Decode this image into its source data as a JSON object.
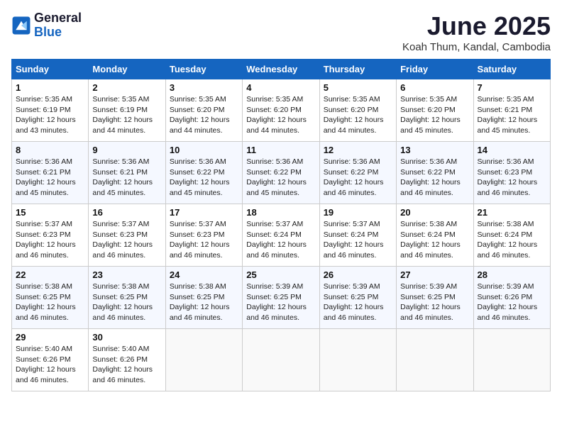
{
  "logo": {
    "line1": "General",
    "line2": "Blue"
  },
  "title": "June 2025",
  "subtitle": "Koah Thum, Kandal, Cambodia",
  "days_of_week": [
    "Sunday",
    "Monday",
    "Tuesday",
    "Wednesday",
    "Thursday",
    "Friday",
    "Saturday"
  ],
  "weeks": [
    [
      {
        "day": 1,
        "sunrise": "5:35 AM",
        "sunset": "6:19 PM",
        "daylight": "12 hours and 43 minutes."
      },
      {
        "day": 2,
        "sunrise": "5:35 AM",
        "sunset": "6:19 PM",
        "daylight": "12 hours and 44 minutes."
      },
      {
        "day": 3,
        "sunrise": "5:35 AM",
        "sunset": "6:20 PM",
        "daylight": "12 hours and 44 minutes."
      },
      {
        "day": 4,
        "sunrise": "5:35 AM",
        "sunset": "6:20 PM",
        "daylight": "12 hours and 44 minutes."
      },
      {
        "day": 5,
        "sunrise": "5:35 AM",
        "sunset": "6:20 PM",
        "daylight": "12 hours and 44 minutes."
      },
      {
        "day": 6,
        "sunrise": "5:35 AM",
        "sunset": "6:20 PM",
        "daylight": "12 hours and 45 minutes."
      },
      {
        "day": 7,
        "sunrise": "5:35 AM",
        "sunset": "6:21 PM",
        "daylight": "12 hours and 45 minutes."
      }
    ],
    [
      {
        "day": 8,
        "sunrise": "5:36 AM",
        "sunset": "6:21 PM",
        "daylight": "12 hours and 45 minutes."
      },
      {
        "day": 9,
        "sunrise": "5:36 AM",
        "sunset": "6:21 PM",
        "daylight": "12 hours and 45 minutes."
      },
      {
        "day": 10,
        "sunrise": "5:36 AM",
        "sunset": "6:22 PM",
        "daylight": "12 hours and 45 minutes."
      },
      {
        "day": 11,
        "sunrise": "5:36 AM",
        "sunset": "6:22 PM",
        "daylight": "12 hours and 45 minutes."
      },
      {
        "day": 12,
        "sunrise": "5:36 AM",
        "sunset": "6:22 PM",
        "daylight": "12 hours and 46 minutes."
      },
      {
        "day": 13,
        "sunrise": "5:36 AM",
        "sunset": "6:22 PM",
        "daylight": "12 hours and 46 minutes."
      },
      {
        "day": 14,
        "sunrise": "5:36 AM",
        "sunset": "6:23 PM",
        "daylight": "12 hours and 46 minutes."
      }
    ],
    [
      {
        "day": 15,
        "sunrise": "5:37 AM",
        "sunset": "6:23 PM",
        "daylight": "12 hours and 46 minutes."
      },
      {
        "day": 16,
        "sunrise": "5:37 AM",
        "sunset": "6:23 PM",
        "daylight": "12 hours and 46 minutes."
      },
      {
        "day": 17,
        "sunrise": "5:37 AM",
        "sunset": "6:23 PM",
        "daylight": "12 hours and 46 minutes."
      },
      {
        "day": 18,
        "sunrise": "5:37 AM",
        "sunset": "6:24 PM",
        "daylight": "12 hours and 46 minutes."
      },
      {
        "day": 19,
        "sunrise": "5:37 AM",
        "sunset": "6:24 PM",
        "daylight": "12 hours and 46 minutes."
      },
      {
        "day": 20,
        "sunrise": "5:38 AM",
        "sunset": "6:24 PM",
        "daylight": "12 hours and 46 minutes."
      },
      {
        "day": 21,
        "sunrise": "5:38 AM",
        "sunset": "6:24 PM",
        "daylight": "12 hours and 46 minutes."
      }
    ],
    [
      {
        "day": 22,
        "sunrise": "5:38 AM",
        "sunset": "6:25 PM",
        "daylight": "12 hours and 46 minutes."
      },
      {
        "day": 23,
        "sunrise": "5:38 AM",
        "sunset": "6:25 PM",
        "daylight": "12 hours and 46 minutes."
      },
      {
        "day": 24,
        "sunrise": "5:38 AM",
        "sunset": "6:25 PM",
        "daylight": "12 hours and 46 minutes."
      },
      {
        "day": 25,
        "sunrise": "5:39 AM",
        "sunset": "6:25 PM",
        "daylight": "12 hours and 46 minutes."
      },
      {
        "day": 26,
        "sunrise": "5:39 AM",
        "sunset": "6:25 PM",
        "daylight": "12 hours and 46 minutes."
      },
      {
        "day": 27,
        "sunrise": "5:39 AM",
        "sunset": "6:25 PM",
        "daylight": "12 hours and 46 minutes."
      },
      {
        "day": 28,
        "sunrise": "5:39 AM",
        "sunset": "6:26 PM",
        "daylight": "12 hours and 46 minutes."
      }
    ],
    [
      {
        "day": 29,
        "sunrise": "5:40 AM",
        "sunset": "6:26 PM",
        "daylight": "12 hours and 46 minutes."
      },
      {
        "day": 30,
        "sunrise": "5:40 AM",
        "sunset": "6:26 PM",
        "daylight": "12 hours and 46 minutes."
      },
      null,
      null,
      null,
      null,
      null
    ]
  ]
}
